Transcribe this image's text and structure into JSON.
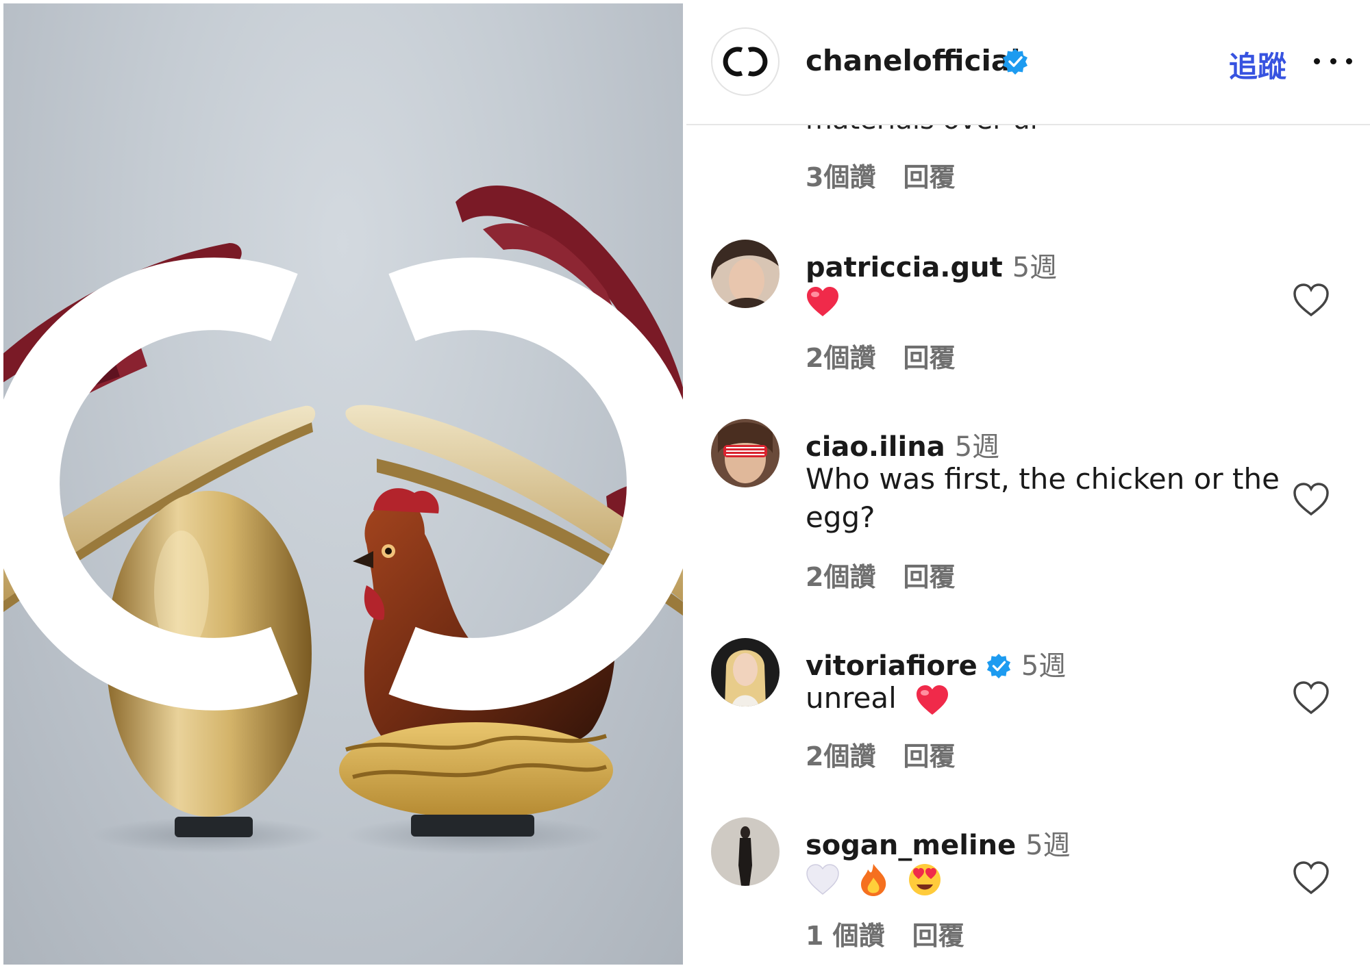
{
  "post": {
    "image_alt_logo": "CHANEL CC",
    "brand_color": "#3753e0",
    "verified_color": "#1d9bf0"
  },
  "header": {
    "username": "chanelofficial",
    "follow_label": "追蹤",
    "more_icon": "more-horizontal-icon"
  },
  "partial_comment": {
    "text": "materials over ur",
    "likes": "3個讚",
    "reply": "回覆"
  },
  "comments": [
    {
      "username": "patriccia.gut",
      "time": "5週",
      "verified": false,
      "text": "",
      "emojis": [
        "red-heart"
      ],
      "likes": "2個讚",
      "reply": "回覆"
    },
    {
      "username": "ciao.ilina",
      "time": "5週",
      "verified": false,
      "text": "Who was first, the chicken or the egg?",
      "emojis": [],
      "likes": "2個讚",
      "reply": "回覆"
    },
    {
      "username": "vitoriafiore",
      "time": "5週",
      "verified": true,
      "text": "unreal",
      "emojis": [
        "red-heart"
      ],
      "likes": "2個讚",
      "reply": "回覆"
    },
    {
      "username": "sogan_meline",
      "time": "5週",
      "verified": false,
      "text": "",
      "emojis": [
        "white-heart",
        "fire",
        "heart-eyes"
      ],
      "likes": "1 個讚",
      "reply": "回覆"
    }
  ]
}
